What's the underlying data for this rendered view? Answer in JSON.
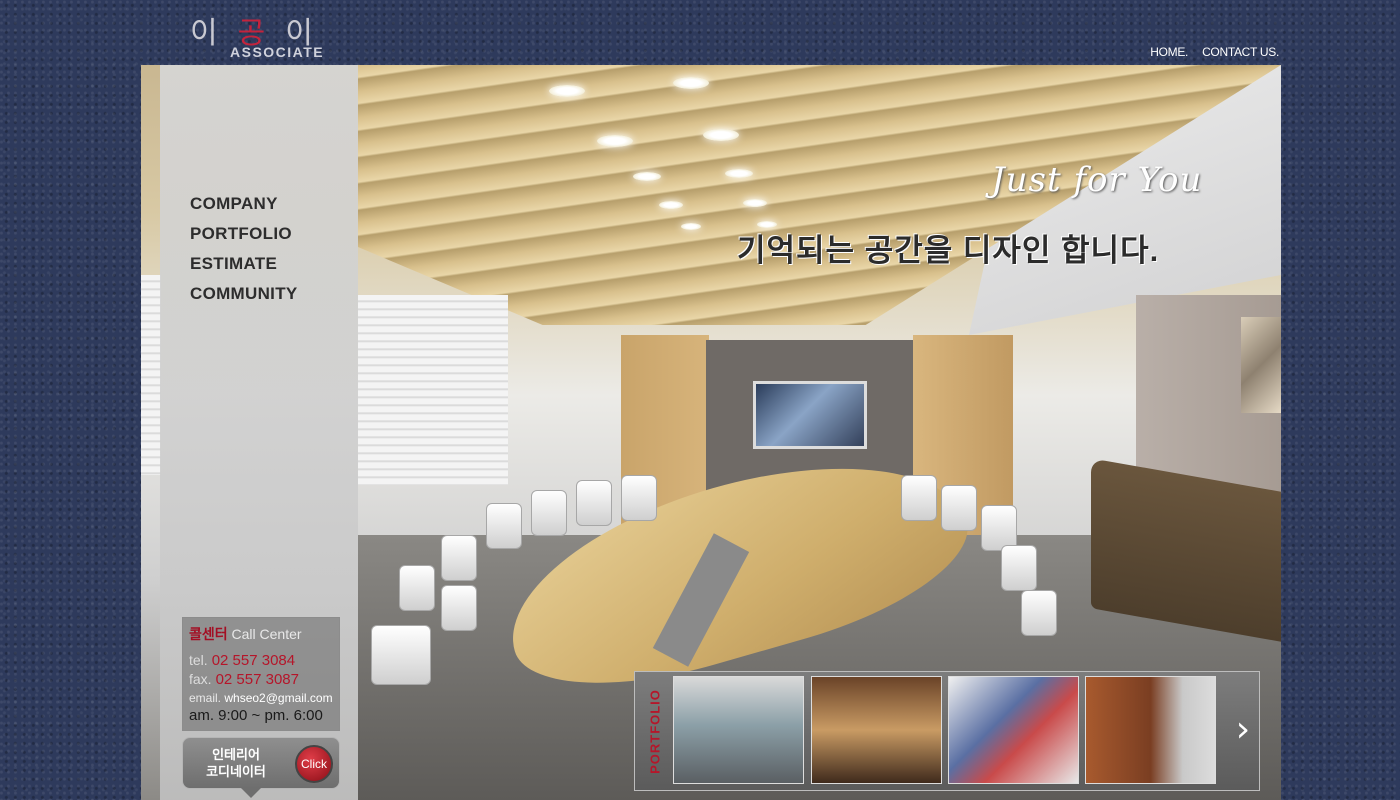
{
  "logo": {
    "korean_left": "이",
    "korean_mid": "공",
    "korean_right": "이",
    "sub": "ASSOCIATE"
  },
  "top_nav": {
    "home": "HOME.",
    "contact": "CONTACT US."
  },
  "hero": {
    "tagline_en": "Just for You",
    "tagline_ko": "기억되는 공간을 디자인 합니다."
  },
  "menu": {
    "items": [
      "COMPANY",
      "PORTFOLIO",
      "ESTIMATE",
      "COMMUNITY"
    ]
  },
  "call_center": {
    "title_ko": "콜센터",
    "title_en": "Call Center",
    "tel_label": "tel.",
    "tel": "02 557 3084",
    "fax_label": "fax.",
    "fax": "02 557 3087",
    "email_label": "email.",
    "email": "whseo2@gmail.com",
    "hours": "am. 9:00 ~ pm. 6:00"
  },
  "coordinator": {
    "line1": "인테리어",
    "line2": "코디네이터",
    "button": "Click"
  },
  "portfolio": {
    "label": "PORTFOLIO",
    "next": "›"
  },
  "colors": {
    "accent": "#b5162a",
    "background": "#2e3a5c"
  }
}
